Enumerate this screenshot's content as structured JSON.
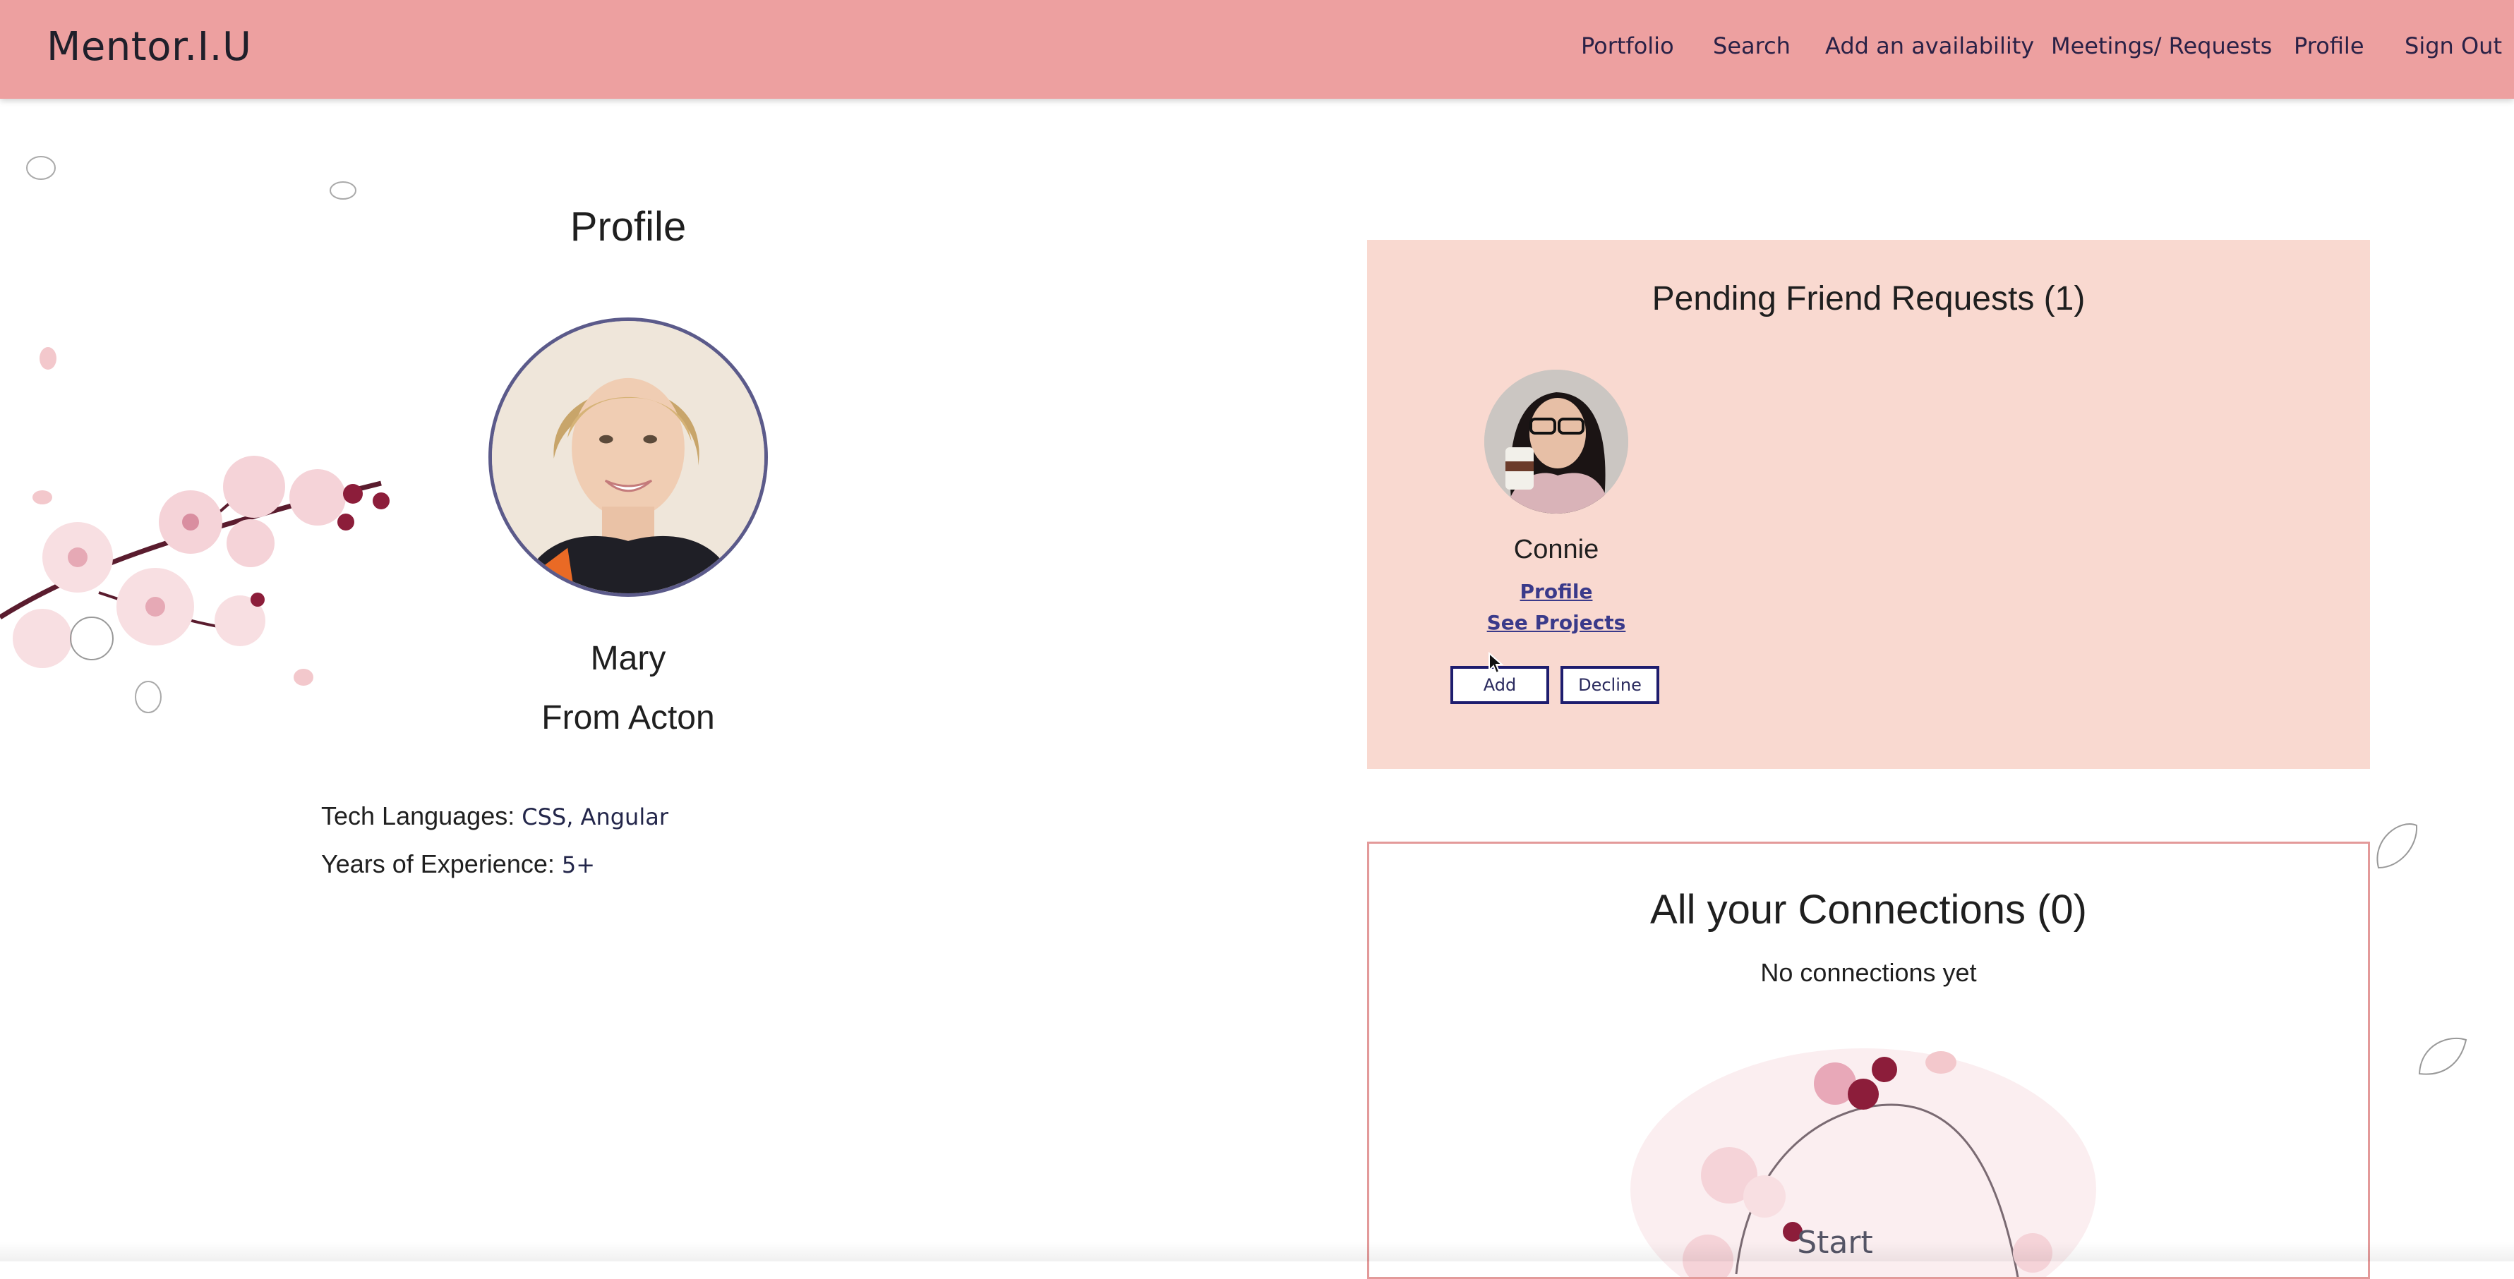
{
  "brand": "Mentor.I.U",
  "nav": {
    "items": [
      {
        "label": "Portfolio"
      },
      {
        "label": "Search"
      },
      {
        "label": "Add an availability"
      },
      {
        "label": "Meetings/ Requests"
      },
      {
        "label": "Profile"
      },
      {
        "label": "Sign Out"
      }
    ]
  },
  "profile": {
    "title": "Profile",
    "name": "Mary",
    "from": "From Acton",
    "tech_label": "Tech Languages:",
    "tech_value": "CSS, Angular",
    "exp_label": "Years of Experience:",
    "exp_value": "5+"
  },
  "pending": {
    "title": "Pending Friend Requests (1)",
    "request": {
      "name": "Connie",
      "profile_link": "Profile",
      "projects_link": "See Projects",
      "add_label": "Add",
      "decline_label": "Decline"
    }
  },
  "connections": {
    "title": "All your Connections (0)",
    "empty_text": "No connections yet",
    "start_label": "Start"
  },
  "colors": {
    "navbar": "#eda0a0",
    "pending_bg": "#f9d9d0",
    "connections_border": "#e39a9a",
    "button_border": "#1e1d6e"
  }
}
